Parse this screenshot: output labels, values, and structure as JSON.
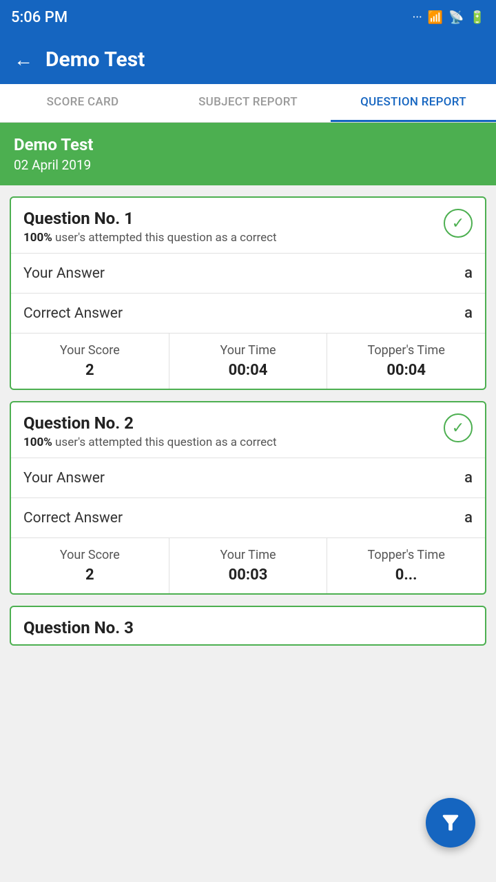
{
  "statusBar": {
    "time": "5:06 PM"
  },
  "header": {
    "title": "Demo Test",
    "backLabel": "←"
  },
  "tabs": [
    {
      "label": "SCORE CARD",
      "active": false
    },
    {
      "label": "SUBJECT REPORT",
      "active": false
    },
    {
      "label": "QUESTION REPORT",
      "active": true
    }
  ],
  "banner": {
    "testName": "Demo Test",
    "testDate": "02 April 2019"
  },
  "questions": [
    {
      "number": "Question No. 1",
      "statPercent": "100%",
      "statText": " user's attempted this question as a correct",
      "yourAnswer": "Your Answer",
      "yourAnswerValue": "a",
      "correctAnswer": "Correct Answer",
      "correctAnswerValue": "a",
      "yourScore": "Your Score",
      "yourScoreValue": "2",
      "yourTime": "Your Time",
      "yourTimeValue": "00:04",
      "toppersTime": "Topper's Time",
      "toppersTimeValue": "00:04"
    },
    {
      "number": "Question No. 2",
      "statPercent": "100%",
      "statText": " user's attempted this question as a correct",
      "yourAnswer": "Your Answer",
      "yourAnswerValue": "a",
      "correctAnswer": "Correct Answer",
      "correctAnswerValue": "a",
      "yourScore": "Your Score",
      "yourScoreValue": "2",
      "yourTime": "Your Time",
      "yourTimeValue": "00:03",
      "toppersTime": "Topper's Time",
      "toppersTimeValue": "0..."
    }
  ],
  "partialQuestion": {
    "number": "Question No. 3"
  },
  "fab": {
    "label": "Filter"
  }
}
